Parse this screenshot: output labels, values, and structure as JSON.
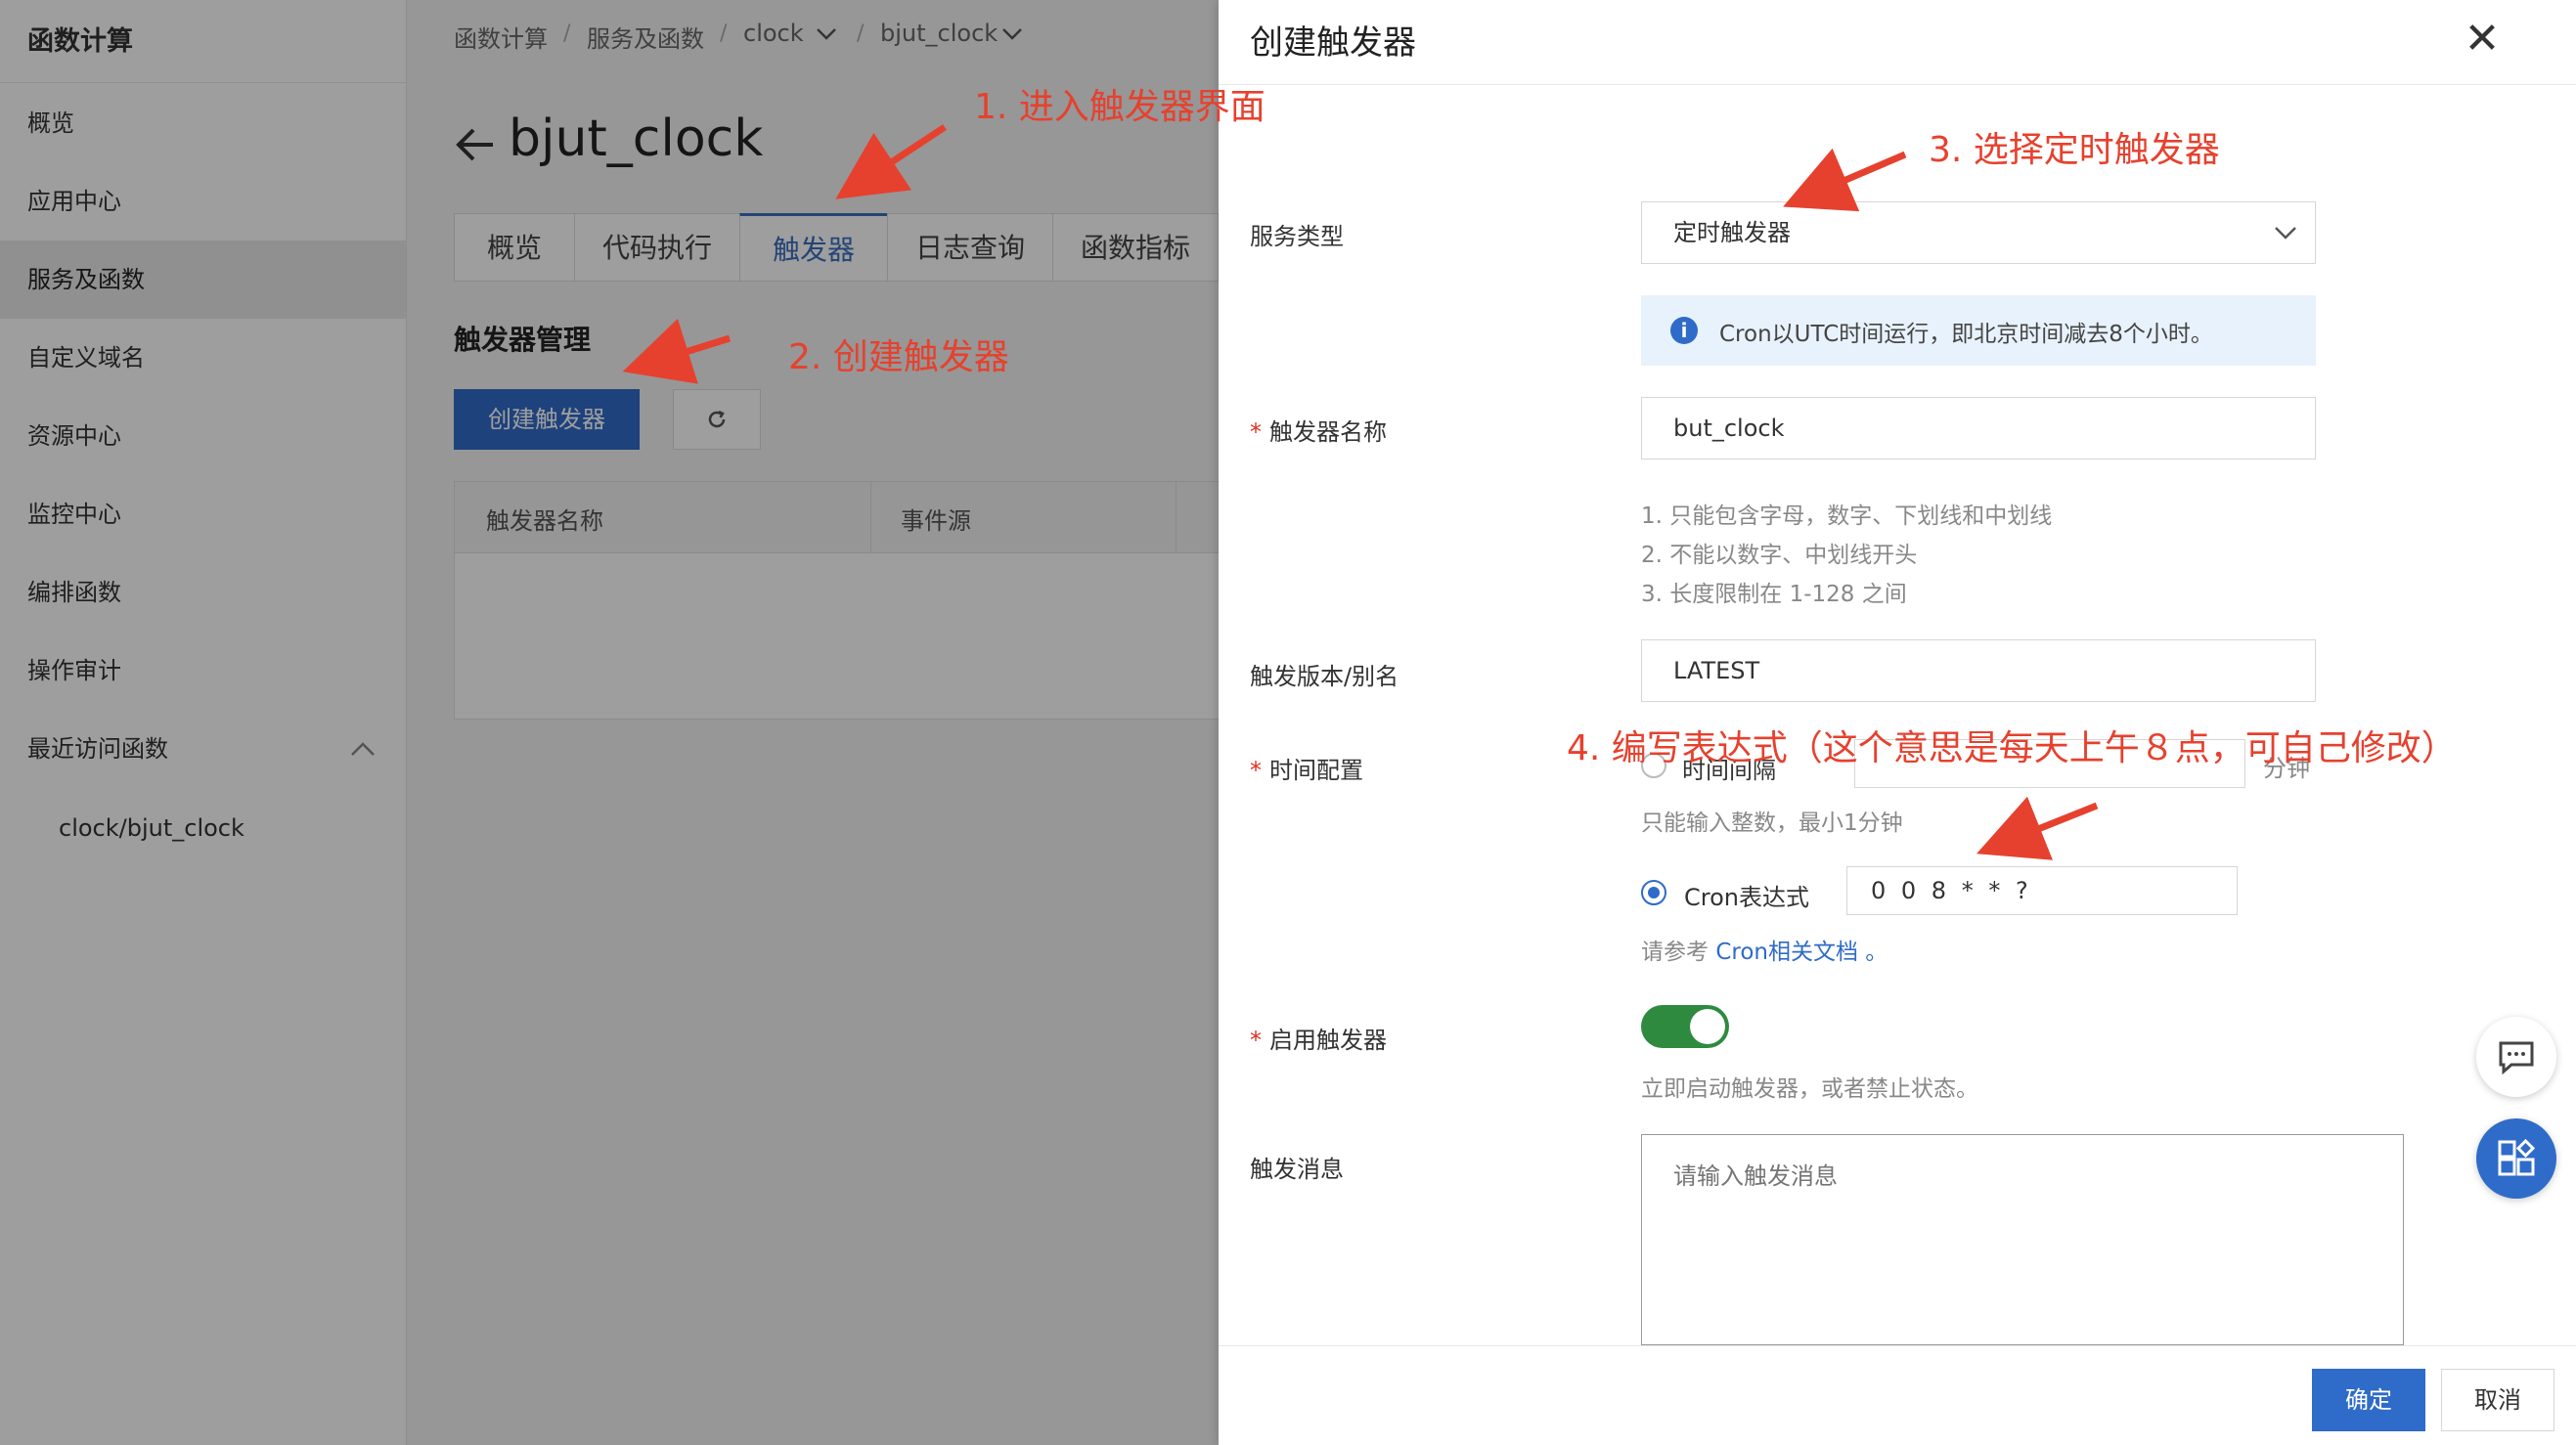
{
  "sidebar": {
    "title": "函数计算",
    "items": [
      {
        "label": "概览",
        "active": false
      },
      {
        "label": "应用中心",
        "active": false
      },
      {
        "label": "服务及函数",
        "active": true
      },
      {
        "label": "自定义域名",
        "active": false
      },
      {
        "label": "资源中心",
        "active": false
      },
      {
        "label": "监控中心",
        "active": false
      },
      {
        "label": "编排函数",
        "active": false
      },
      {
        "label": "操作审计",
        "active": false
      },
      {
        "label": "最近访问函数",
        "active": false
      }
    ],
    "recent_function": "clock/bjut_clock"
  },
  "breadcrumb": [
    "函数计算",
    "服务及函数",
    "clock",
    "bjut_clock"
  ],
  "page": {
    "title": "bjut_clock",
    "tabs": [
      "概览",
      "代码执行",
      "触发器",
      "日志查询",
      "函数指标"
    ],
    "active_tab": "触发器",
    "section_title": "触发器管理",
    "create_button": "创建触发器",
    "table_headers": [
      "触发器名称",
      "事件源"
    ]
  },
  "drawer": {
    "title": "创建触发器",
    "service_type_label": "服务类型",
    "service_type_value": "定时触发器",
    "info_text": "Cron以UTC时间运行，即北京时间减去8个小时。",
    "trigger_name_label": "触发器名称",
    "trigger_name_value": "but_clock",
    "name_rules": [
      "1. 只能包含字母，数字、下划线和中划线",
      "2. 不能以数字、中划线开头",
      "3. 长度限制在 1-128 之间"
    ],
    "version_label": "触发版本/别名",
    "version_value": "LATEST",
    "time_config_label": "时间配置",
    "interval_option": "时间间隔",
    "interval_unit": "分钟",
    "interval_help": "只能输入整数，最小1分钟",
    "cron_option": "Cron表达式",
    "cron_value": "0 0 8 * * ?",
    "cron_help_prefix": "请参考",
    "cron_help_link": "Cron相关文档",
    "cron_help_suffix": "。",
    "enable_label": "启用触发器",
    "enable_state": true,
    "enable_help": "立即启动触发器，或者禁止状态。",
    "message_label": "触发消息",
    "message_placeholder": "请输入触发消息",
    "ok_button": "确定",
    "cancel_button": "取消"
  },
  "annotations": {
    "step1": "1. 进入触发器界面",
    "step2": "2. 创建触发器",
    "step3": "3. 选择定时触发器",
    "step4": "4. 编写表达式（这个意思是每天上午８点，可自己修改）"
  },
  "colors": {
    "primary": "#2f6bc8",
    "annotation": "#e6412e",
    "toggle_on": "#2e8a3f",
    "required": "#e0301e"
  }
}
